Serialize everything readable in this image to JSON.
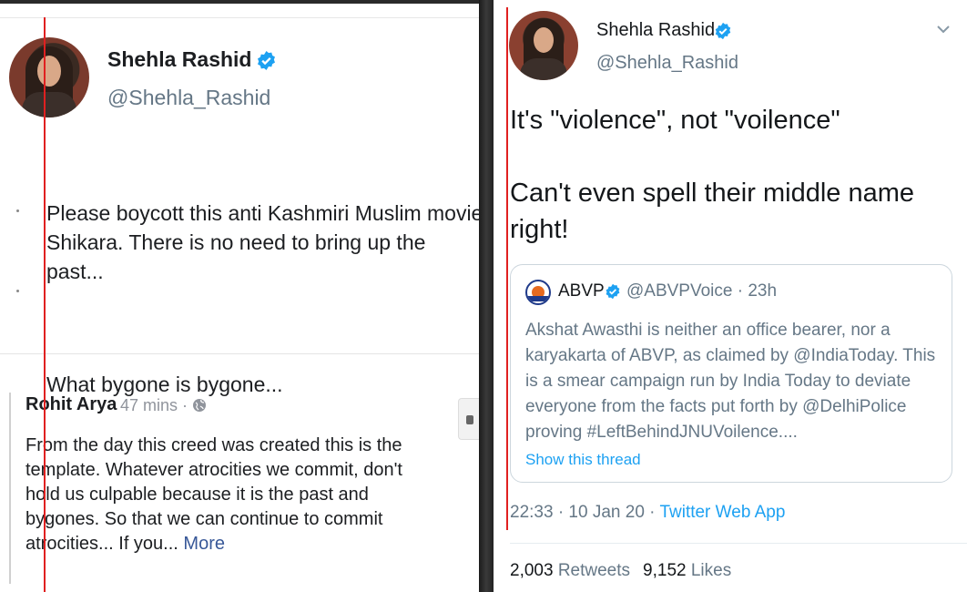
{
  "left": {
    "author_name": "Shehla Rashid",
    "author_handle": "@Shehla_Rashid",
    "tweet_paragraph_1": "Please boycott this anti Kashmiri Muslim movie Shikara. There is no need to bring up the past...",
    "tweet_paragraph_2": "What bygone is bygone...",
    "comment": {
      "author": "Rohit Arya",
      "time": "47 mins ·",
      "text": "From the day this creed was created this is the template. Whatever atrocities we commit, don't hold us culpable because it is the past and bygones. So that we can continue to commit atrocities... If you...",
      "more_label": "More"
    }
  },
  "right": {
    "author_name": "Shehla Rashid",
    "author_handle": "@Shehla_Rashid",
    "tweet_line_1": "It's \"violence\", not \"voilence\"",
    "tweet_line_2": "Can't even spell their middle name right!",
    "quote": {
      "name": "ABVP",
      "handle_time": "@ABVPVoice · 23h",
      "text": "Akshat Awasthi is neither an office bearer, nor a karyakarta of ABVP, as claimed by @IndiaToday. This is a smear campaign run by India Today to deviate everyone from the facts put forth by @DelhiPolice proving #LeftBehindJNUVoilence....",
      "show_thread": "Show this thread"
    },
    "meta_time": "22:33 · 10 Jan 20 ·",
    "meta_app": "Twitter Web App",
    "retweets_count": "2,003",
    "retweets_label": "Retweets",
    "likes_count": "9,152",
    "likes_label": "Likes"
  },
  "colors": {
    "twitter_blue": "#1da1f2",
    "facebook_link": "#385898",
    "annotation_red": "#e02020",
    "secondary_text": "#657786"
  },
  "icons": [
    "verified-badge-icon",
    "globe-icon",
    "chevron-down-icon",
    "abvp-logo-icon"
  ]
}
